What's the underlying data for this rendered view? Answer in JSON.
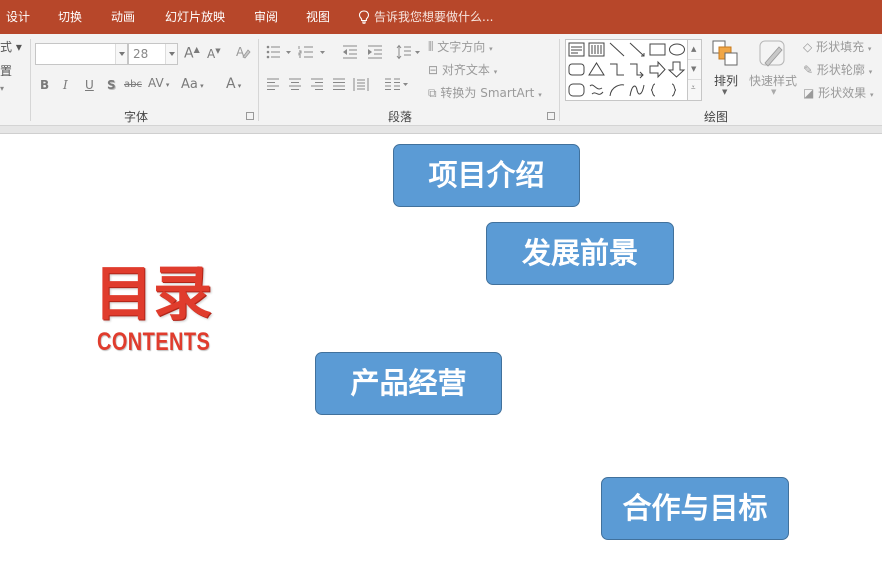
{
  "tabs": [
    {
      "label": "设计"
    },
    {
      "label": "切换"
    },
    {
      "label": "动画"
    },
    {
      "label": "幻灯片放映"
    },
    {
      "label": "审阅"
    },
    {
      "label": "视图"
    }
  ],
  "tell_me": {
    "placeholder": "告诉我您想要做什么..."
  },
  "ribbon": {
    "partial_left": {
      "label1": "式",
      "label2": "置"
    },
    "font": {
      "group_label": "字体",
      "size_value": "28",
      "bold": "B",
      "italic": "I",
      "underline": "U",
      "shadow": "S",
      "strike": "abc",
      "spacing": "AV",
      "case": "Aa",
      "color": "A"
    },
    "paragraph": {
      "group_label": "段落",
      "text_direction": "文字方向",
      "align_text": "对齐文本",
      "smartart": "转换为 SmartArt"
    },
    "drawing": {
      "group_label": "绘图",
      "arrange": "排列",
      "quick_styles": "快速样式",
      "shape_fill": "形状填充",
      "shape_outline": "形状轮廓",
      "shape_effects": "形状效果"
    }
  },
  "slide": {
    "title_cn": "目录",
    "title_en": "CONTENTS",
    "topics": [
      {
        "label": "项目介绍"
      },
      {
        "label": "发展前景"
      },
      {
        "label": "产品经营"
      },
      {
        "label": "合作与目标"
      }
    ]
  },
  "colors": {
    "accent": "#b7472a",
    "topic_fill": "#5b9bd5",
    "title_red": "#e03c2d"
  }
}
